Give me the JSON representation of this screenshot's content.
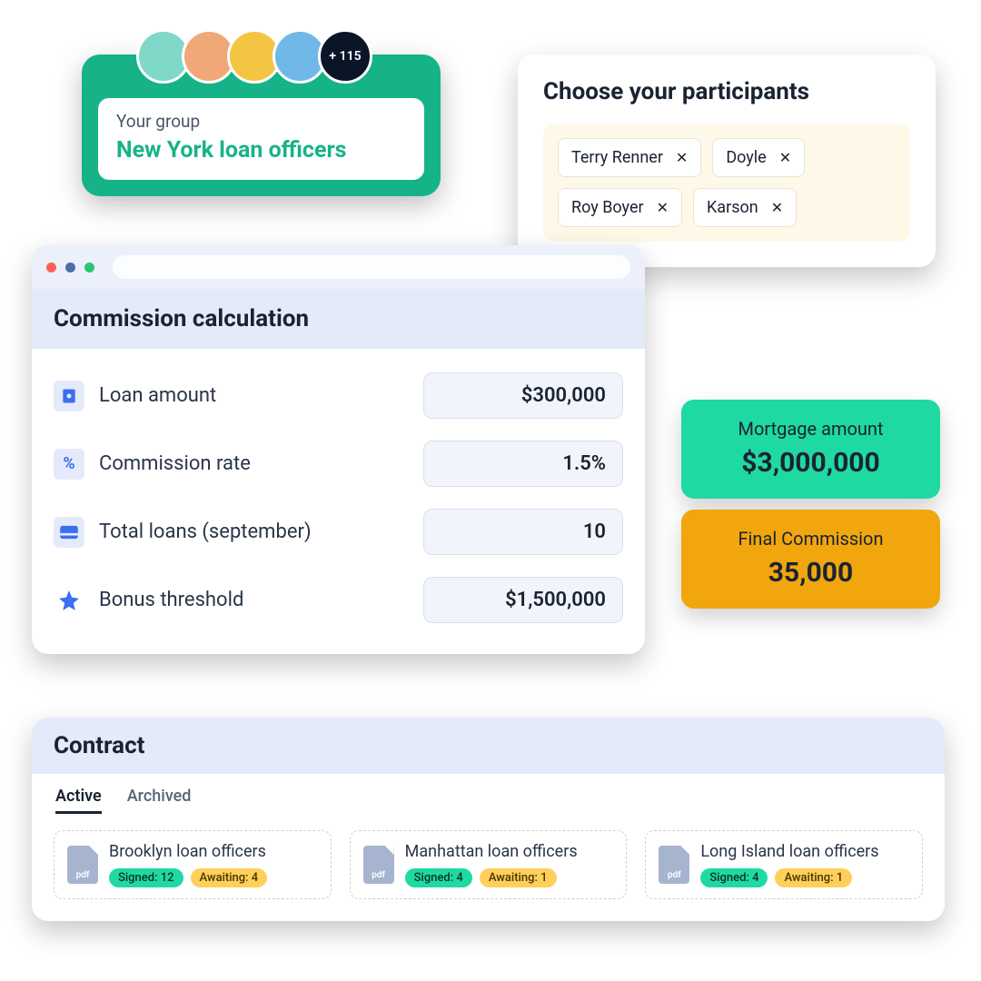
{
  "group": {
    "label": "Your group",
    "name": "New York loan officers",
    "overflow": "+ 115",
    "avatar_colors": [
      "#7fd8c8",
      "#f0a878",
      "#f4c542",
      "#6fb8e8"
    ]
  },
  "participants": {
    "title": "Choose your participants",
    "chips": [
      "Terry Renner",
      "Doyle",
      "Roy Boyer",
      "Karson"
    ]
  },
  "calc": {
    "title": "Commission calculation",
    "rows": [
      {
        "label": "Loan amount",
        "value": "$300,000",
        "icon": "money-icon"
      },
      {
        "label": "Commission rate",
        "value": "1.5%",
        "icon": "percent-icon"
      },
      {
        "label": "Total loans (september)",
        "value": "10",
        "icon": "card-icon"
      },
      {
        "label": "Bonus threshold",
        "value": "$1,500,000",
        "icon": "star-icon"
      }
    ]
  },
  "results": {
    "mortgage": {
      "label": "Mortgage amount",
      "value": "$3,000,000"
    },
    "commission": {
      "label": "Final Commission",
      "value": "35,000"
    }
  },
  "contract": {
    "title": "Contract",
    "tabs": {
      "active": "Active",
      "archived": "Archived"
    },
    "pdf_label": "pdf",
    "items": [
      {
        "name": "Brooklyn loan officers",
        "signed": "Signed: 12",
        "awaiting": "Awaiting: 4"
      },
      {
        "name": "Manhattan loan officers",
        "signed": "Signed: 4",
        "awaiting": "Awaiting: 1"
      },
      {
        "name": "Long Island loan officers",
        "signed": "Signed: 4",
        "awaiting": "Awaiting: 1"
      }
    ]
  }
}
